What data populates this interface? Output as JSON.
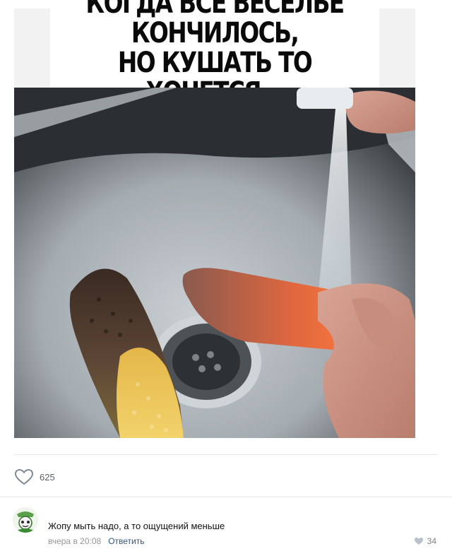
{
  "meme": {
    "caption_line1": "КОГДА ВСЕ ВЕСЕЛЬЕ КОНЧИЛОСЬ,",
    "caption_line2": "НО КУШАТЬ ТО ХОЧЕТСЯ..."
  },
  "post": {
    "likes_count": "625",
    "like_icon": "heart-outline-icon"
  },
  "comment": {
    "text": "Жопу мыть надо, а то ощущений меньше",
    "time": "вчера в 20:08",
    "reply_label": "Ответить",
    "likes_count": "34",
    "like_icon": "heart-filled-icon"
  },
  "colors": {
    "link": "#2a5885",
    "muted": "#939699",
    "divider": "#e7e8ec"
  }
}
